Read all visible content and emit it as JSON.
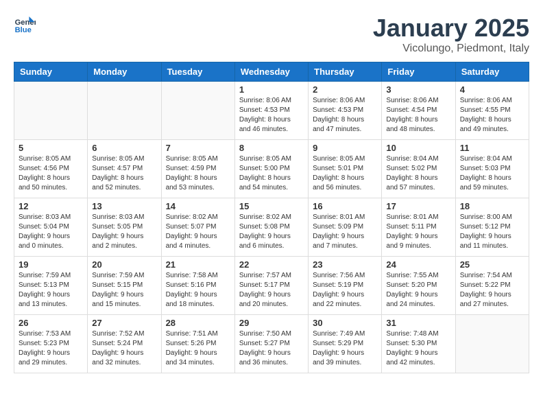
{
  "header": {
    "logo_line1": "General",
    "logo_line2": "Blue",
    "title": "January 2025",
    "subtitle": "Vicolungo, Piedmont, Italy"
  },
  "weekdays": [
    "Sunday",
    "Monday",
    "Tuesday",
    "Wednesday",
    "Thursday",
    "Friday",
    "Saturday"
  ],
  "weeks": [
    [
      {
        "day": "",
        "info": ""
      },
      {
        "day": "",
        "info": ""
      },
      {
        "day": "",
        "info": ""
      },
      {
        "day": "1",
        "info": "Sunrise: 8:06 AM\nSunset: 4:53 PM\nDaylight: 8 hours and 46 minutes."
      },
      {
        "day": "2",
        "info": "Sunrise: 8:06 AM\nSunset: 4:53 PM\nDaylight: 8 hours and 47 minutes."
      },
      {
        "day": "3",
        "info": "Sunrise: 8:06 AM\nSunset: 4:54 PM\nDaylight: 8 hours and 48 minutes."
      },
      {
        "day": "4",
        "info": "Sunrise: 8:06 AM\nSunset: 4:55 PM\nDaylight: 8 hours and 49 minutes."
      }
    ],
    [
      {
        "day": "5",
        "info": "Sunrise: 8:05 AM\nSunset: 4:56 PM\nDaylight: 8 hours and 50 minutes."
      },
      {
        "day": "6",
        "info": "Sunrise: 8:05 AM\nSunset: 4:57 PM\nDaylight: 8 hours and 52 minutes."
      },
      {
        "day": "7",
        "info": "Sunrise: 8:05 AM\nSunset: 4:59 PM\nDaylight: 8 hours and 53 minutes."
      },
      {
        "day": "8",
        "info": "Sunrise: 8:05 AM\nSunset: 5:00 PM\nDaylight: 8 hours and 54 minutes."
      },
      {
        "day": "9",
        "info": "Sunrise: 8:05 AM\nSunset: 5:01 PM\nDaylight: 8 hours and 56 minutes."
      },
      {
        "day": "10",
        "info": "Sunrise: 8:04 AM\nSunset: 5:02 PM\nDaylight: 8 hours and 57 minutes."
      },
      {
        "day": "11",
        "info": "Sunrise: 8:04 AM\nSunset: 5:03 PM\nDaylight: 8 hours and 59 minutes."
      }
    ],
    [
      {
        "day": "12",
        "info": "Sunrise: 8:03 AM\nSunset: 5:04 PM\nDaylight: 9 hours and 0 minutes."
      },
      {
        "day": "13",
        "info": "Sunrise: 8:03 AM\nSunset: 5:05 PM\nDaylight: 9 hours and 2 minutes."
      },
      {
        "day": "14",
        "info": "Sunrise: 8:02 AM\nSunset: 5:07 PM\nDaylight: 9 hours and 4 minutes."
      },
      {
        "day": "15",
        "info": "Sunrise: 8:02 AM\nSunset: 5:08 PM\nDaylight: 9 hours and 6 minutes."
      },
      {
        "day": "16",
        "info": "Sunrise: 8:01 AM\nSunset: 5:09 PM\nDaylight: 9 hours and 7 minutes."
      },
      {
        "day": "17",
        "info": "Sunrise: 8:01 AM\nSunset: 5:11 PM\nDaylight: 9 hours and 9 minutes."
      },
      {
        "day": "18",
        "info": "Sunrise: 8:00 AM\nSunset: 5:12 PM\nDaylight: 9 hours and 11 minutes."
      }
    ],
    [
      {
        "day": "19",
        "info": "Sunrise: 7:59 AM\nSunset: 5:13 PM\nDaylight: 9 hours and 13 minutes."
      },
      {
        "day": "20",
        "info": "Sunrise: 7:59 AM\nSunset: 5:15 PM\nDaylight: 9 hours and 15 minutes."
      },
      {
        "day": "21",
        "info": "Sunrise: 7:58 AM\nSunset: 5:16 PM\nDaylight: 9 hours and 18 minutes."
      },
      {
        "day": "22",
        "info": "Sunrise: 7:57 AM\nSunset: 5:17 PM\nDaylight: 9 hours and 20 minutes."
      },
      {
        "day": "23",
        "info": "Sunrise: 7:56 AM\nSunset: 5:19 PM\nDaylight: 9 hours and 22 minutes."
      },
      {
        "day": "24",
        "info": "Sunrise: 7:55 AM\nSunset: 5:20 PM\nDaylight: 9 hours and 24 minutes."
      },
      {
        "day": "25",
        "info": "Sunrise: 7:54 AM\nSunset: 5:22 PM\nDaylight: 9 hours and 27 minutes."
      }
    ],
    [
      {
        "day": "26",
        "info": "Sunrise: 7:53 AM\nSunset: 5:23 PM\nDaylight: 9 hours and 29 minutes."
      },
      {
        "day": "27",
        "info": "Sunrise: 7:52 AM\nSunset: 5:24 PM\nDaylight: 9 hours and 32 minutes."
      },
      {
        "day": "28",
        "info": "Sunrise: 7:51 AM\nSunset: 5:26 PM\nDaylight: 9 hours and 34 minutes."
      },
      {
        "day": "29",
        "info": "Sunrise: 7:50 AM\nSunset: 5:27 PM\nDaylight: 9 hours and 36 minutes."
      },
      {
        "day": "30",
        "info": "Sunrise: 7:49 AM\nSunset: 5:29 PM\nDaylight: 9 hours and 39 minutes."
      },
      {
        "day": "31",
        "info": "Sunrise: 7:48 AM\nSunset: 5:30 PM\nDaylight: 9 hours and 42 minutes."
      },
      {
        "day": "",
        "info": ""
      }
    ]
  ]
}
